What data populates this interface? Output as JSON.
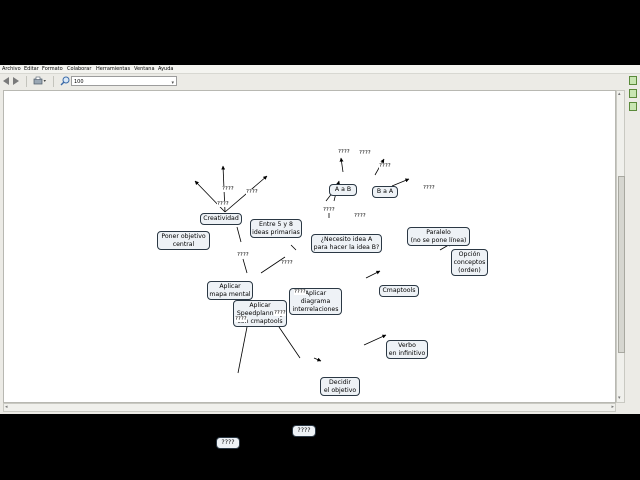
{
  "menu": [
    {
      "label": "Archivo"
    },
    {
      "label": "Editar"
    },
    {
      "label": "Formato"
    },
    {
      "label": "Colaborar"
    },
    {
      "label": "Herramientas"
    },
    {
      "label": "Ventana"
    },
    {
      "label": "Ayuda"
    }
  ],
  "toolbar": {
    "zoom_value": "100",
    "icons": [
      "back-arrow-icon",
      "forward-arrow-icon",
      "print-icon",
      "zoom-icon",
      "chevron-down-icon"
    ]
  },
  "colors": {
    "node_fill": "#eef2f6",
    "node_border": "#2b3844",
    "edge": "#000000",
    "canvas": "#ffffff"
  },
  "concept_map": {
    "nodes": [
      {
        "id": "n1",
        "label": "Aplicar\nSpeedplanning\ncon cmaptools"
      },
      {
        "id": "n2",
        "label": "Aplicar\nmapa mental"
      },
      {
        "id": "n3",
        "label": "Poner objetivo\ncentral"
      },
      {
        "id": "n4",
        "label": "Creatividad"
      },
      {
        "id": "n5",
        "label": "Entre 5 y 8\nideas primarias"
      },
      {
        "id": "n6",
        "label": "Aplicar\ndiagrama\ninterrelaciones"
      },
      {
        "id": "n7",
        "label": "¿Necesito idea A\npara hacer la idea B?"
      },
      {
        "id": "n8",
        "label": "A a B"
      },
      {
        "id": "n9",
        "label": "B a A"
      },
      {
        "id": "n10",
        "label": "Paralelo\n(no se pone línea)"
      },
      {
        "id": "n11",
        "label": "Cmaptools"
      },
      {
        "id": "n12",
        "label": "Opción\nconceptos\n(orden)"
      },
      {
        "id": "n13",
        "label": "Decidir\nel objetivo"
      },
      {
        "id": "n14",
        "label": "Verbo\nen infinitivo"
      },
      {
        "id": "n15",
        "label": "????"
      },
      {
        "id": "n16",
        "label": "????"
      }
    ],
    "links": [
      {
        "id": "l1",
        "label": "????"
      },
      {
        "id": "l2",
        "label": "????"
      },
      {
        "id": "l3",
        "label": "????"
      },
      {
        "id": "l4",
        "label": "????"
      },
      {
        "id": "l5",
        "label": "????"
      },
      {
        "id": "l6",
        "label": "????"
      },
      {
        "id": "l7",
        "label": "????"
      },
      {
        "id": "l8",
        "label": "????"
      },
      {
        "id": "l9",
        "label": "????"
      },
      {
        "id": "l10",
        "label": "????"
      },
      {
        "id": "l11",
        "label": "????"
      },
      {
        "id": "l12",
        "label": "????"
      },
      {
        "id": "l13",
        "label": "????"
      },
      {
        "id": "l14",
        "label": "????"
      }
    ]
  }
}
